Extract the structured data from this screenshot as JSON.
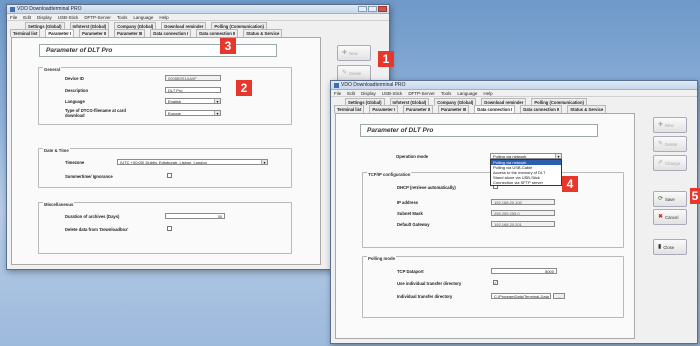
{
  "window1": {
    "title": "VDO Downloadterminal PRO",
    "menu": [
      "File",
      "Edit",
      "Display",
      "USB-Stick",
      "DFTP-Server",
      "Tools",
      "Language",
      "Help"
    ],
    "tabs_row1": [
      "Settings (Global)",
      "Infoterst (Global)",
      "Company (Global)",
      "Download reminder",
      "Polling (Communication)"
    ],
    "tabs_row2": [
      "Terminal list",
      "Parameter I",
      "Parameter II",
      "Parameter III",
      "Data connection I",
      "Data connection II",
      "Status & Service"
    ],
    "page_heading": "Parameter of   DLT Pro",
    "general": {
      "title": "General",
      "device_id_label": "Device ID",
      "device_id_value": "0008B0S1AA0F",
      "description_label": "Description",
      "description_value": "DLT Pro",
      "language_label": "Language",
      "language_value": "English",
      "dtco_label": "Type of DTCO-filename at card download",
      "dtco_value": "Europe"
    },
    "datetime": {
      "title": "Date & Time",
      "timezone_label": "Timezone",
      "timezone_value": "(UTC +00:00) Dublin, Edinburgh, Lisbon, London",
      "summertime_label": "Summertime/ Ignorance"
    },
    "misc": {
      "title": "Miscellaneous",
      "duration_label": "Duration of archives (Days)",
      "duration_value": "30",
      "delete_label": "Delete data from 'Downloadbox'"
    },
    "buttons": {
      "new": "New",
      "delete": "Delete"
    }
  },
  "window2": {
    "title": "VDO Downloadterminal PRO",
    "menu": [
      "File",
      "Edit",
      "Display",
      "USB-Stick",
      "DFTP-Server",
      "Tools",
      "Language",
      "Help"
    ],
    "tabs_row1": [
      "Settings (Global)",
      "Infoterst (Global)",
      "Company (Global)",
      "Download reminder",
      "Polling (Communication)"
    ],
    "tabs_row2": [
      "Terminal list",
      "Parameter I",
      "Parameter II",
      "Parameter III",
      "Data connection I",
      "Data connection II",
      "Status & Service"
    ],
    "page_heading": "Parameter of   DLT Pro",
    "operation_label": "Operation mode",
    "operation_value": "Polling via network",
    "dropdown_options": [
      "Polling via network",
      "Polling via USB-Cable",
      "Access to the memory of DLT",
      "Stand alone via USB-Stick",
      "Connection via SFTP server"
    ],
    "tcp": {
      "title": "TCP/IP configuration",
      "dhcp_label": "DHCP (retrieve automatically)",
      "ip_label": "IP address",
      "ip_value": "192.168.20.100",
      "subnet_label": "Subnet Mask",
      "subnet_value": "255.255.255.0",
      "gateway_label": "Default Gateway",
      "gateway_value": "192.168.20.201"
    },
    "polling": {
      "title": "Polling mode",
      "port_label": "TCP Dataport",
      "port_value": "8000",
      "use_dir_label": "Use individual transfer directory",
      "dir_label": "Individual transfer directory",
      "dir_value": "C:\\ProgramData\\Terminal-Data",
      "browse": "..."
    },
    "buttons": {
      "new": "New",
      "delete": "Delete",
      "change": "Change",
      "save": "Save",
      "cancel": "Cancel",
      "close": "Close"
    }
  },
  "callouts": [
    "1",
    "2",
    "3",
    "4",
    "5"
  ],
  "colors": {
    "callout": "#e7362c",
    "highlight": "#2c5fb0"
  }
}
